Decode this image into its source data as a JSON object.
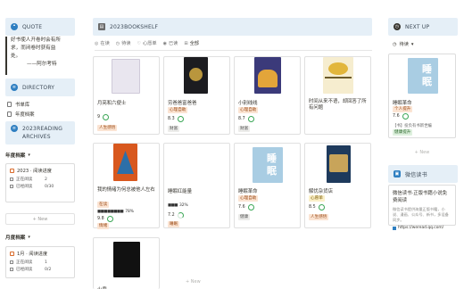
{
  "left": {
    "quote_header": "QUOTE",
    "quote_lines": [
      "好书使人开卷时会有所",
      "求，而闭卷时获有益",
      "处。"
    ],
    "quote_author": "——阿尔考特",
    "directory_header": "DIRECTORY",
    "directory_items": [
      "书单库",
      "年度档案"
    ],
    "archives_header": [
      "2023READING",
      "ARCHIVES"
    ],
    "year_title": "年度档案",
    "year_card": {
      "title": "2023 · 阅读进度",
      "rows": [
        {
          "label": "正在阅读",
          "value": "2"
        },
        {
          "label": "已经阅读",
          "value": "0/30"
        }
      ]
    },
    "year_new": "+ New",
    "month_title": "月度档案",
    "month_card": {
      "title": "1月 · 阅读进度",
      "rows": [
        {
          "label": "正在阅读",
          "value": "1"
        },
        {
          "label": "已经阅读",
          "value": "0/2"
        }
      ]
    }
  },
  "center": {
    "header": "2023BOOKSHELF",
    "tabs": [
      "在读",
      "待读",
      "心愿单",
      "已读",
      "全部"
    ],
    "tab_glyphs": [
      "◎",
      "◷",
      "♡",
      "◉",
      "⊞"
    ],
    "books": [
      {
        "title": "月亮和六便士",
        "rating": "9",
        "tag": "人生感悟",
        "tag_color": "orange",
        "cover": "#e9e6ef"
      },
      {
        "title": "穷爸爸富爸爸",
        "tag": "心理自助",
        "rating": "8.3",
        "tag2": "财富",
        "tag_color": "orange",
        "cover": "#1c1c20"
      },
      {
        "title": "小别线线",
        "tag": "心理自助",
        "rating": "8.7",
        "tag2": "财富",
        "tag_color": "orange",
        "cover": "#3b3a7a"
      },
      {
        "title": "时间从来不语，却回答了所有问题",
        "tag": "",
        "rating": "",
        "tag_color": "orange",
        "cover": "#f1d880"
      },
      {
        "title": "我的情绪为何总被他人左右",
        "tag": "在读",
        "progress": "78%",
        "rating": "9.8",
        "tag2": "情绪",
        "tag_color": "orange",
        "cover": "#d8581e"
      },
      {
        "title": "睡眠红能量",
        "progress": "32%",
        "rating": "7.2",
        "tag2": "睡眠",
        "cover": "#ffffff"
      },
      {
        "title": "睡眠革命",
        "tag": "心理自助",
        "rating": "7.6",
        "tag2": "健康",
        "tag_color": "orange",
        "cover": "#a9cde3"
      },
      {
        "title": "解忧杂货店",
        "tag": "心愿单",
        "rating": "8.5",
        "tag2": "人生感悟",
        "tag_color": "yellow",
        "cover": "#1e3a5c"
      },
      {
        "title": "火鼎",
        "cover": "#111111"
      }
    ],
    "new_label": "+ New"
  },
  "right": {
    "header": "NEXT UP",
    "filter": "待读",
    "book": {
      "title": "睡眠革命",
      "tag": "个人提升",
      "rating": "7.6",
      "note": "【书】投负有书新世编",
      "tag2": "健康提升"
    },
    "new_label": "+ New",
    "wx_header": "微信读书",
    "wx_title": "微信读书·正版书籍小说免费阅读",
    "wx_desc": "微信读书提供海量正版书籍，小说、漫画、公众号、新书，多设备同步。",
    "wx_url": "https://weread.qq.com/"
  },
  "colors": {
    "header_bg": "#e5eff7",
    "accent": "#2f7fc1"
  }
}
